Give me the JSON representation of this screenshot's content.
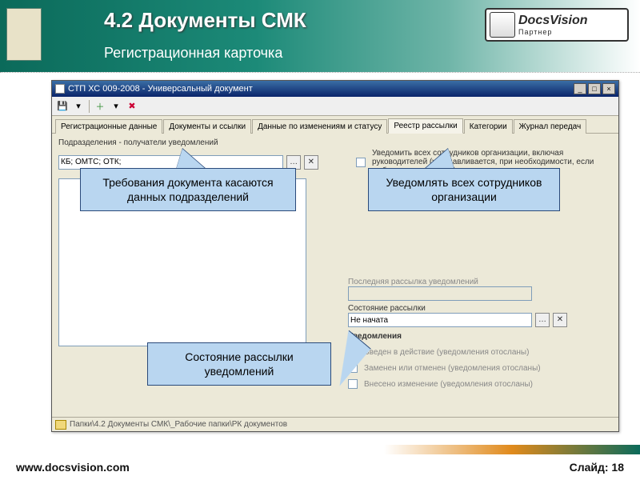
{
  "slide": {
    "title": "4.2 Документы СМК",
    "subtitle": "Регистрационная карточка",
    "footer_url": "www.docsvision.com",
    "footer_page": "Слайд: 18",
    "logo_text": "DocsVision",
    "logo_sub": "Партнер"
  },
  "app": {
    "window_title": "СТП ХС 009-2008 - Универсальный документ",
    "tabs": [
      "Регистрационные данные",
      "Документы и ссылки",
      "Данные по изменениям и статусу",
      "Реестр рассылки",
      "Категории",
      "Журнал передач"
    ],
    "active_tab_index": 3,
    "group_title": "Подразделения - получатели уведомлений",
    "dept_value": "КБ; ОМТС; ОТК;",
    "notify_all": "Уведомить всех сотрудников организации, включая руководителей (устанавливается, при необходимости, если выбрана организация)",
    "last_send_label": "Последняя рассылка уведомлений",
    "last_send_value": "",
    "status_label": "Состояние рассылки",
    "status_value": "Не начата",
    "notices_heading": "Уведомления",
    "notices": [
      "Введен в действие (уведомления отосланы)",
      "Заменен или отменен (уведомления отосланы)",
      "Внесено изменение (уведомления отосланы)"
    ],
    "status_path": "Папки\\4.2   Документы СМК\\_Рабочие папки\\РК документов"
  },
  "callouts": {
    "c1": "Требования документа касаются данных подразделений",
    "c2": "Уведомлять всех сотрудников организации",
    "c3": "Состояние рассылки уведомлений"
  }
}
